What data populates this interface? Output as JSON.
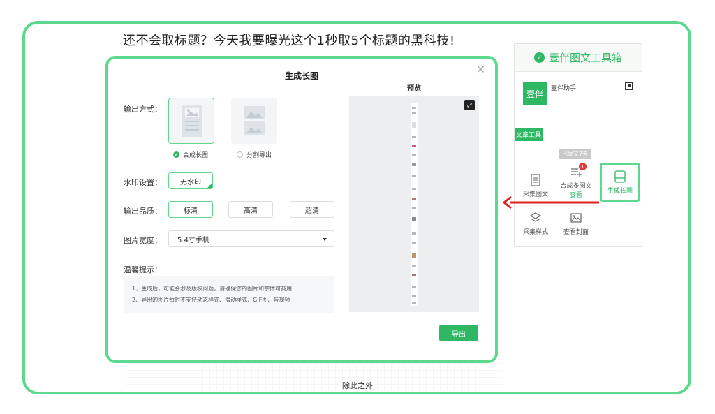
{
  "headline": "还不会取标题？今天我要曝光这个1秒取5个标题的黑科技!",
  "dialog": {
    "title": "生成长图",
    "close_icon": "close-icon",
    "output_mode_label": "输出方式：",
    "modes": [
      {
        "label": "合成长图",
        "selected": true
      },
      {
        "label": "分割导出",
        "selected": false
      }
    ],
    "watermark_label": "水印设置：",
    "watermark_option": "无水印",
    "quality_label": "输出品质：",
    "quality_options": [
      "标清",
      "高清",
      "超清"
    ],
    "quality_selected": "标清",
    "width_label": "图片宽度：",
    "width_value": "5.4寸手机",
    "tips_label": "温馨提示：",
    "tips": [
      "1、生成后，可能会涉及版权问题，请确保您的图片和字体可商用",
      "2、导出的图片暂时不支持动态样式、滑动样式、GIF图、音视频"
    ],
    "preview_title": "预览",
    "export_button": "导出"
  },
  "panel": {
    "title": "壹伴图文工具箱",
    "avatar_text": "壹伴",
    "assistant": "壹伴助手",
    "section_tag": "文章工具",
    "sent_tag": "已发文7天",
    "tools": [
      {
        "label": "采集图文",
        "icon": "document-icon"
      },
      {
        "label": "合成多图文",
        "icon": "list-add-icon",
        "badge": "1",
        "link": "查看"
      },
      {
        "label": "生成长图",
        "icon": "long-image-icon",
        "active": true
      },
      {
        "label": "采集样式",
        "icon": "layers-icon"
      },
      {
        "label": "查看封面",
        "icon": "image-icon"
      }
    ]
  },
  "bottom_text": "除此之外",
  "colors": {
    "accent": "#2fb864",
    "highlight_border": "#5ed88e",
    "arrow": "#e02020"
  }
}
